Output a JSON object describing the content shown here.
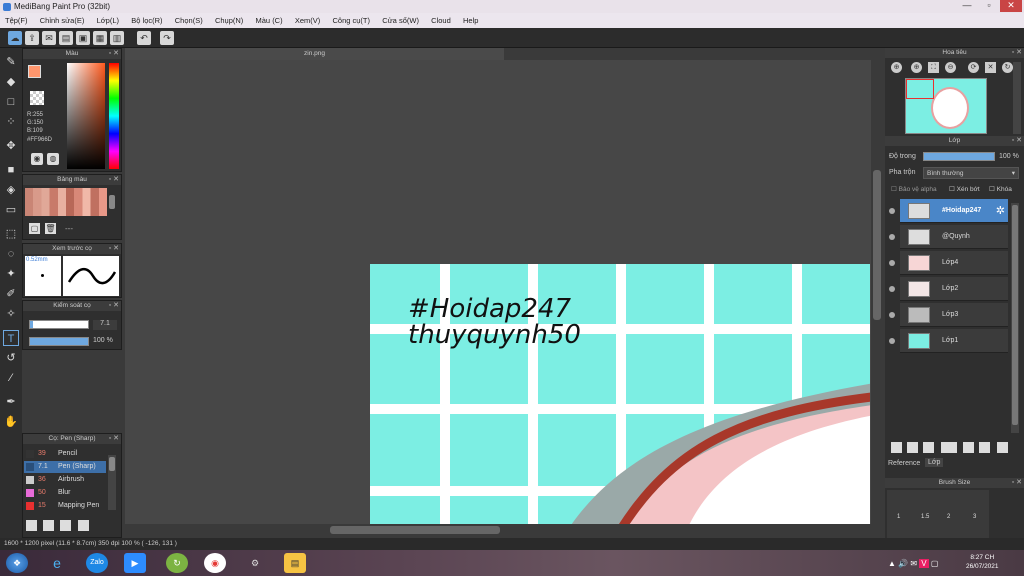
{
  "window": {
    "title": "MediBang Paint Pro (32bit)"
  },
  "menu": [
    "Tệp(F)",
    "Chỉnh sửa(E)",
    "Lớp(L)",
    "Bộ lọc(R)",
    "Chọn(S)",
    "Chụp(N)",
    "Màu (C)",
    "Xem(V)",
    "Công cụ(T)",
    "Cửa sổ(W)",
    "Cloud",
    "Help"
  ],
  "color_panel": {
    "title": "Màu",
    "r": "R:255",
    "g": "G:150",
    "b": "B:109",
    "hex": "#FF966D",
    "main_color": "#FF966D"
  },
  "palette_panel": {
    "title": "Bảng màu",
    "extra": "---"
  },
  "brush_preview": {
    "title": "Xem trước cọ",
    "size": "0.52mm"
  },
  "control_panel": {
    "title": "Kiểm soát cọ",
    "size_value": "7.1",
    "opacity_value": "100 %"
  },
  "brush_list": {
    "title": "Cọ: Pen (Sharp)",
    "items": [
      {
        "size": "39",
        "name": "Pencil",
        "color": "#333333"
      },
      {
        "size": "7.1",
        "name": "Pen (Sharp)",
        "color": "#3d6fa8"
      },
      {
        "size": "36",
        "name": "Airbrush",
        "color": "#cccccc"
      },
      {
        "size": "50",
        "name": "Blur",
        "color": "#e86bd8"
      },
      {
        "size": "15",
        "name": "Mapping Pen",
        "color": "#e83030"
      }
    ]
  },
  "document": {
    "tab": "zin.png",
    "text_line1": "#Hoidap247",
    "text_line2": "thuyquynh50"
  },
  "navigator": {
    "title": "Hoa tiêu"
  },
  "layer_panel": {
    "title": "Lớp",
    "opacity_label": "Độ trong",
    "opacity_value": "100 %",
    "blend_label": "Pha trộn",
    "blend_value": "Bình thường",
    "protect_alpha": "Bảo vệ alpha",
    "clipping": "Xén bớt",
    "lock": "Khóa",
    "layers": [
      "#Hoidap247",
      "@Quynh",
      "Lớp4",
      "Lớp2",
      "Lớp3",
      "Lớp1"
    ],
    "tabs": [
      "Reference",
      "Lớp"
    ]
  },
  "brush_size_panel": {
    "title": "Brush Size",
    "sizes": [
      "1",
      "1.5",
      "2",
      "3"
    ]
  },
  "status": {
    "text": "1600 * 1200 pixel  (11.6 * 8.7cm)  350 dpi  100 %  ( -126, 131 )"
  },
  "tray": {
    "time": "8:27 CH",
    "date": "26/07/2021"
  }
}
